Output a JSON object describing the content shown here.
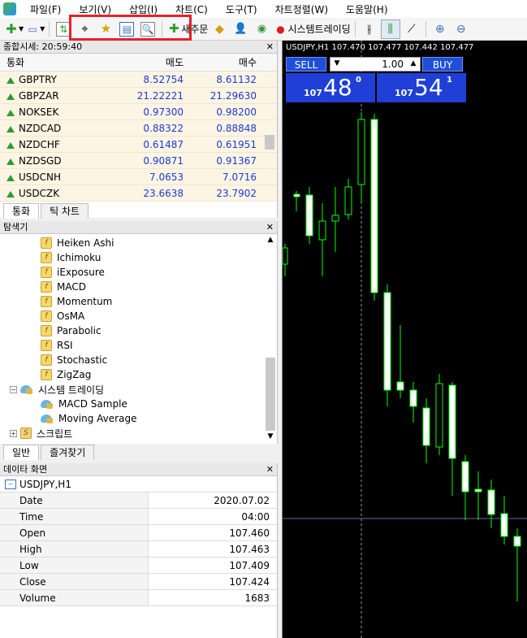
{
  "menubar": {
    "items": [
      "파일(F)",
      "보기(V)",
      "삽입(I)",
      "차트(C)",
      "도구(T)",
      "차트정렬(W)",
      "도움말(H)"
    ]
  },
  "toolbar": {
    "new_order_label": "새주문",
    "autotrading_label": "시스템트레이딩"
  },
  "market_watch": {
    "title": "종합시세: 20:59:40",
    "col_symbol": "통화",
    "col_bid": "매도",
    "col_ask": "매수",
    "rows": [
      {
        "symbol": "GBPTRY",
        "bid": "8.52754",
        "ask": "8.61132"
      },
      {
        "symbol": "GBPZAR",
        "bid": "21.22221",
        "ask": "21.29630"
      },
      {
        "symbol": "NOKSEK",
        "bid": "0.97300",
        "ask": "0.98200"
      },
      {
        "symbol": "NZDCAD",
        "bid": "0.88322",
        "ask": "0.88848"
      },
      {
        "symbol": "NZDCHF",
        "bid": "0.61487",
        "ask": "0.61951"
      },
      {
        "symbol": "NZDSGD",
        "bid": "0.90871",
        "ask": "0.91367"
      },
      {
        "symbol": "USDCNH",
        "bid": "7.0653",
        "ask": "7.0716"
      },
      {
        "symbol": "USDCZK",
        "bid": "23.6638",
        "ask": "23.7902"
      }
    ],
    "tabs": [
      "통화",
      "틱 차트"
    ]
  },
  "navigator": {
    "title": "탐색기",
    "indicators": [
      "Heiken Ashi",
      "Ichimoku",
      "iExposure",
      "MACD",
      "Momentum",
      "OsMA",
      "Parabolic",
      "RSI",
      "Stochastic",
      "ZigZag"
    ],
    "ea_group": "시스템 트레이딩",
    "eas": [
      "MACD Sample",
      "Moving Average"
    ],
    "scripts_group": "스크립트",
    "tabs": [
      "일반",
      "즐겨찾기"
    ]
  },
  "data_window": {
    "title": "데이타 화면",
    "symbol": "USDJPY,H1",
    "rows": [
      {
        "key": "Date",
        "value": "2020.07.02"
      },
      {
        "key": "Time",
        "value": "04:00"
      },
      {
        "key": "Open",
        "value": "107.460"
      },
      {
        "key": "High",
        "value": "107.463"
      },
      {
        "key": "Low",
        "value": "107.409"
      },
      {
        "key": "Close",
        "value": "107.424"
      },
      {
        "key": "Volume",
        "value": "1683"
      }
    ]
  },
  "chart": {
    "header": "USDJPY,H1  107.470 107.477 107.442 107.477",
    "sell_label": "SELL",
    "buy_label": "BUY",
    "volume": "1.00",
    "sell_prefix": "107",
    "sell_big": "48",
    "sell_sup": "0",
    "buy_prefix": "107",
    "buy_big": "54",
    "buy_sup": "1"
  }
}
